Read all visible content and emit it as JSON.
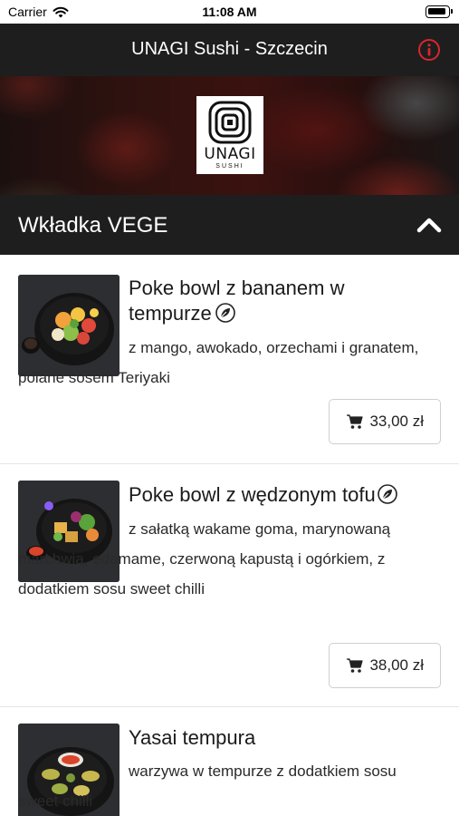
{
  "status_bar": {
    "carrier": "Carrier",
    "time": "11:08 AM"
  },
  "header": {
    "title": "UNAGI Sushi - Szczecin"
  },
  "logo": {
    "name": "UNAGI",
    "subtitle": "SUSHI"
  },
  "category": {
    "title": "Wkładka VEGE"
  },
  "products": [
    {
      "name_line1": "Poke bowl z bananem w",
      "name_line2": "tempurze",
      "description": "z mango, awokado, orzechami i granatem, polane sosem Teriyaki",
      "price": "33,00 zł",
      "icon": "vegetarian-leaf-icon"
    },
    {
      "name_line1": "Poke bowl z wędzonym tofu",
      "description": "z sałatką wakame goma, marynowaną marchwią, edamame, czerwoną kapustą i ogórkiem, z dodatkiem sosu sweet chilli",
      "price": "38,00 zł",
      "icon": "vegetarian-leaf-icon"
    },
    {
      "name_line1": "Yasai tempura",
      "description": "warzywa w tempurze z dodatkiem sosu sweet chilli"
    }
  ],
  "colors": {
    "bar_background": "#1e1e1e",
    "info_icon": "#d9262c",
    "text_white": "#ffffff"
  }
}
